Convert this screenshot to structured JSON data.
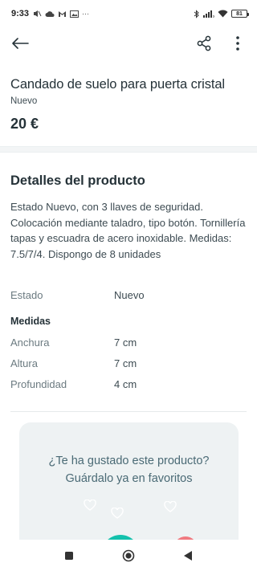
{
  "status_bar": {
    "time": "9:33",
    "battery": "81",
    "left_icons": [
      "mute-icon",
      "cloud-icon",
      "gmail-icon",
      "picture-icon",
      "more-dots"
    ],
    "more": "···"
  },
  "product": {
    "title": "Candado de suelo para puerta cristal",
    "condition": "Nuevo",
    "price": "20 €"
  },
  "details": {
    "section_title": "Detalles del producto",
    "description": "Estado Nuevo, con 3 llaves de seguridad. Colocación mediante taladro, tipo botón. Tornillería tapas y escuadra de acero inoxidable. Medidas: 7.5/7/4. Dispongo de 8 unidades",
    "estado_label": "Estado",
    "estado_value": "Nuevo",
    "medidas_heading": "Medidas",
    "measures": [
      {
        "label": "Anchura",
        "value": "7 cm"
      },
      {
        "label": "Altura",
        "value": "7 cm"
      },
      {
        "label": "Profundidad",
        "value": "4 cm"
      }
    ]
  },
  "favorites_card": {
    "line1": "¿Te ha gustado este producto?",
    "line2": "Guárdalo ya en favoritos"
  },
  "colors": {
    "text_primary": "#253238",
    "accent_green": "#13c1ac",
    "card_bg": "#eef2f3"
  }
}
